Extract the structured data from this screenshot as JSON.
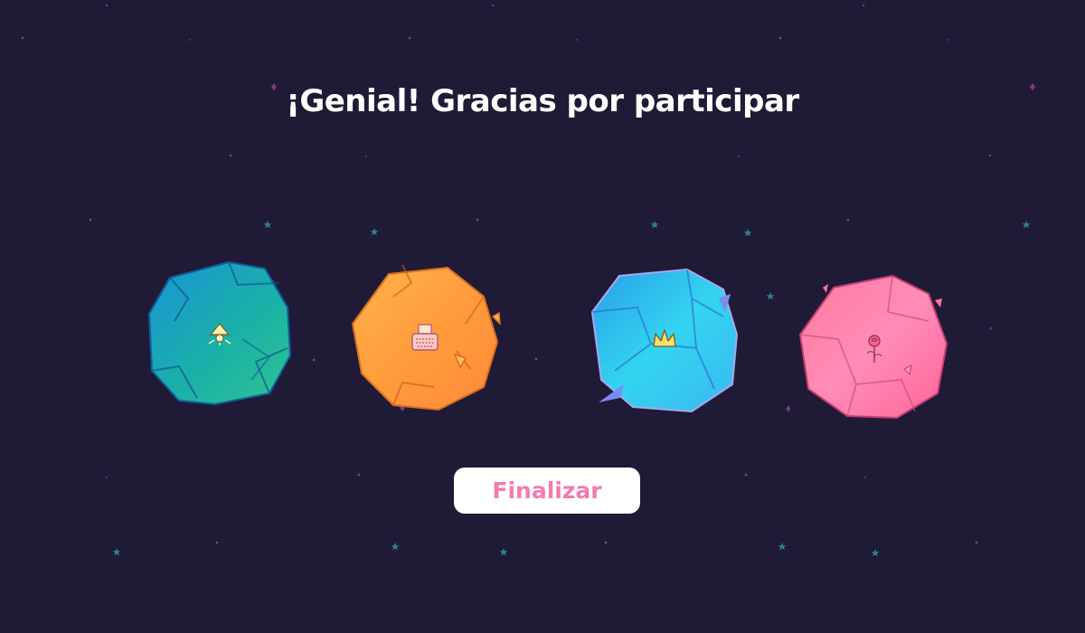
{
  "title": "¡Genial! Gracias por participar",
  "finish_button_label": "Finalizar",
  "colors": {
    "background": "#1f1b36",
    "title": "#ffffff",
    "button_bg": "#ffffff",
    "button_text": "#f57ab0",
    "star_teal": "#2f7f95",
    "star_gold": "#9a8a4a",
    "star_violet": "#5a4a8a"
  },
  "planets": [
    {
      "name": "teal-planet",
      "icon": "lamp-icon",
      "colors": [
        "#1aa6b8",
        "#1576c6",
        "#2ec0a0"
      ]
    },
    {
      "name": "orange-planet",
      "icon": "typewriter-icon",
      "colors": [
        "#ffa43a",
        "#ff8a40",
        "#ffc24a"
      ]
    },
    {
      "name": "cyan-planet",
      "icon": "crown-icon",
      "colors": [
        "#31e0f0",
        "#2a7be8",
        "#5ef0f8"
      ]
    },
    {
      "name": "pink-planet",
      "icon": "rose-icon",
      "colors": [
        "#ff6fa0",
        "#ff88b8",
        "#ff5f8f"
      ]
    }
  ]
}
